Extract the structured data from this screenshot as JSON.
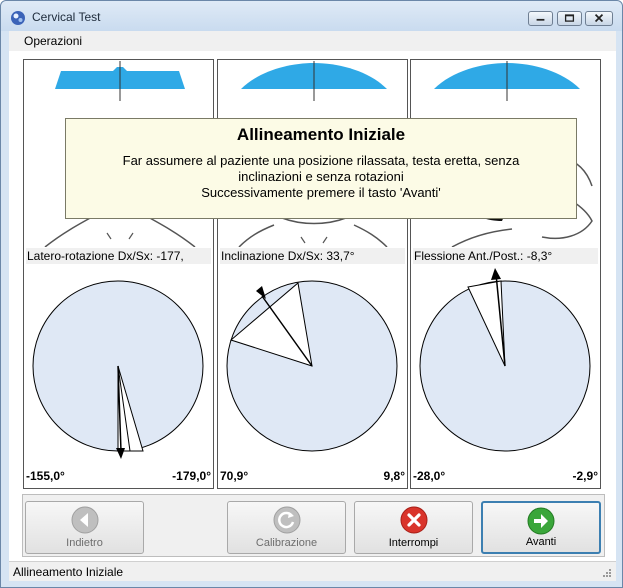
{
  "window": {
    "title": "Cervical Test"
  },
  "menu": {
    "items": [
      {
        "label": "Operazioni"
      }
    ]
  },
  "panels": [
    {
      "readout": "Latero-rotazione  Dx/Sx:  -177,",
      "left_value": "-155,0°",
      "right_value": "-179,0°"
    },
    {
      "readout": "Inclinazione Dx/Sx: 33,7°",
      "left_value": "70,9°",
      "right_value": "9,8°"
    },
    {
      "readout": "Flessione Ant./Post.: -8,3°",
      "left_value": "-28,0°",
      "right_value": "-2,9°"
    }
  ],
  "tooltip": {
    "title": "Allineamento Iniziale",
    "line1": "Far assumere al paziente una posizione rilassata, testa eretta, senza",
    "line2": "inclinazioni e senza rotazioni",
    "line3": "Successivamente premere il tasto 'Avanti'"
  },
  "buttons": {
    "back": "Indietro",
    "calibrate": "Calibrazione",
    "stop": "Interrompi",
    "next": "Avanti"
  },
  "status": {
    "text": "Allineamento Iniziale"
  },
  "colors": {
    "gauge_fill": "#dfe8f5",
    "accent_blue": "#2fa9e6",
    "stop_red": "#d9342b",
    "next_green": "#3aa63a"
  },
  "icons": {
    "app": "app-icon",
    "back": "arrow-left-icon",
    "calibrate": "refresh-icon",
    "stop": "x-circle-icon",
    "next": "arrow-right-icon"
  }
}
